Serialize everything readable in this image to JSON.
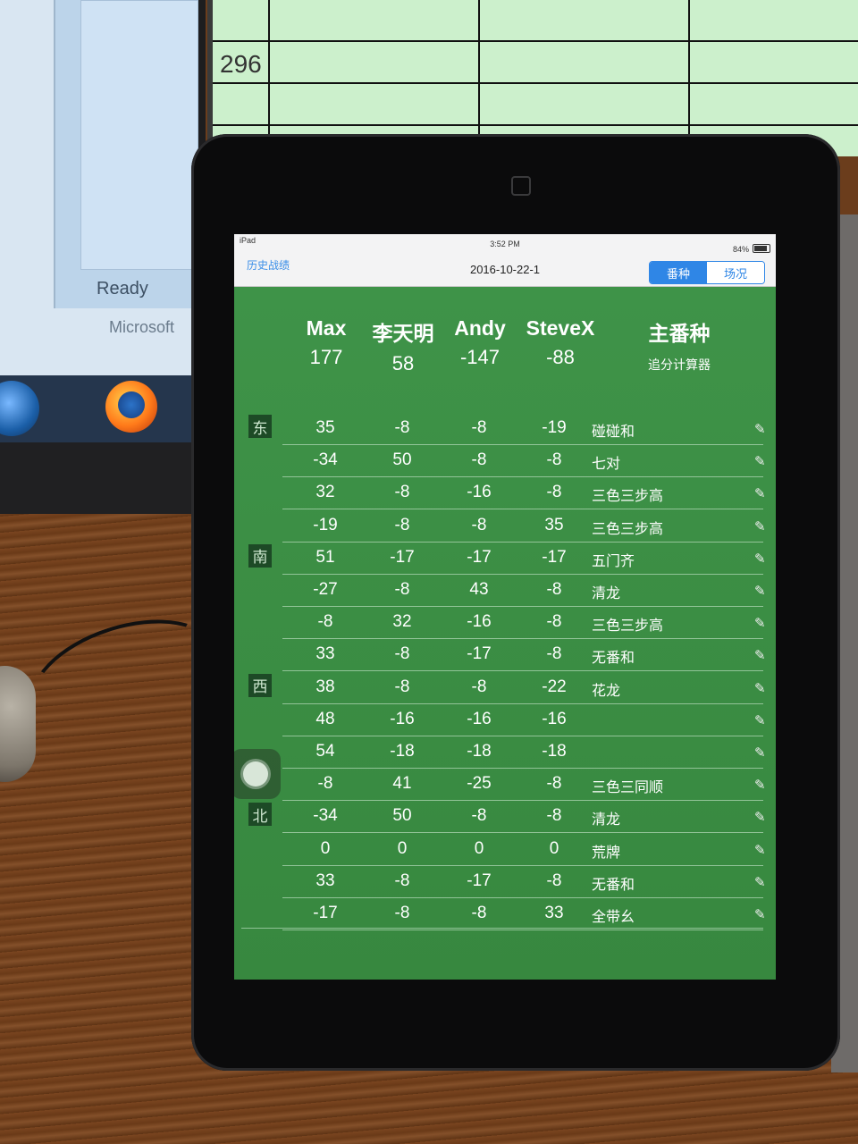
{
  "background": {
    "spreadsheet_cell": "296",
    "excel_status": "Ready",
    "taskbar_label": "Microsoft"
  },
  "statusbar": {
    "carrier": "iPad",
    "time": "3:52 PM",
    "battery": "84%"
  },
  "navbar": {
    "back_label": "历史战绩",
    "title": "2016-10-22-1",
    "segments": [
      "番种",
      "场况"
    ],
    "selected_segment": "番种"
  },
  "header": {
    "players": [
      {
        "name": "Max",
        "total": "177"
      },
      {
        "name": "李天明",
        "total": "58"
      },
      {
        "name": "Andy",
        "total": "-147"
      },
      {
        "name": "SteveX",
        "total": "-88"
      }
    ],
    "main_title": "主番种",
    "main_subtitle": "追分计算器"
  },
  "winds": [
    "东",
    "南",
    "西",
    "北"
  ],
  "rounds": [
    {
      "scores": [
        "35",
        "-8",
        "-8",
        "-19"
      ],
      "fan": "碰碰和"
    },
    {
      "scores": [
        "-34",
        "50",
        "-8",
        "-8"
      ],
      "fan": "七对"
    },
    {
      "scores": [
        "32",
        "-8",
        "-16",
        "-8"
      ],
      "fan": "三色三步高"
    },
    {
      "scores": [
        "-19",
        "-8",
        "-8",
        "35"
      ],
      "fan": "三色三步高"
    },
    {
      "scores": [
        "51",
        "-17",
        "-17",
        "-17"
      ],
      "fan": "五门齐"
    },
    {
      "scores": [
        "-27",
        "-8",
        "43",
        "-8"
      ],
      "fan": "清龙"
    },
    {
      "scores": [
        "-8",
        "32",
        "-16",
        "-8"
      ],
      "fan": "三色三步高"
    },
    {
      "scores": [
        "33",
        "-8",
        "-17",
        "-8"
      ],
      "fan": "无番和"
    },
    {
      "scores": [
        "38",
        "-8",
        "-8",
        "-22"
      ],
      "fan": "花龙"
    },
    {
      "scores": [
        "48",
        "-16",
        "-16",
        "-16"
      ],
      "fan": ""
    },
    {
      "scores": [
        "54",
        "-18",
        "-18",
        "-18"
      ],
      "fan": ""
    },
    {
      "scores": [
        "-8",
        "41",
        "-25",
        "-8"
      ],
      "fan": "三色三同顺"
    },
    {
      "scores": [
        "-34",
        "50",
        "-8",
        "-8"
      ],
      "fan": "清龙"
    },
    {
      "scores": [
        "0",
        "0",
        "0",
        "0"
      ],
      "fan": "荒牌"
    },
    {
      "scores": [
        "33",
        "-8",
        "-17",
        "-8"
      ],
      "fan": "无番和"
    },
    {
      "scores": [
        "-17",
        "-8",
        "-8",
        "33"
      ],
      "fan": "全带幺"
    }
  ],
  "icons": {
    "edit": "pencil-icon",
    "assistive_touch": "assistive-touch-icon"
  },
  "colors": {
    "table_green": "#3c8f45",
    "accent_blue": "#2f86e6"
  }
}
